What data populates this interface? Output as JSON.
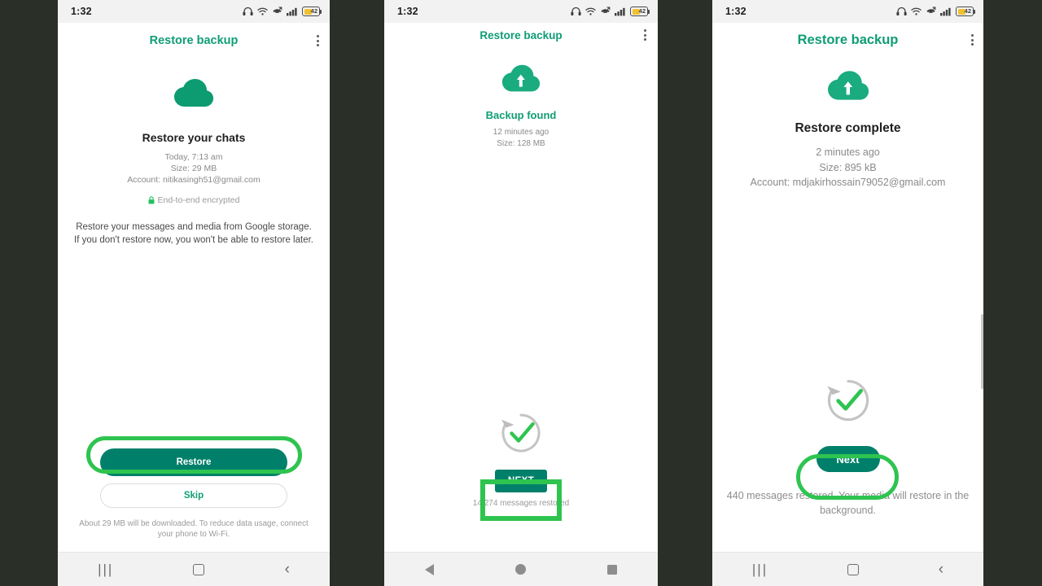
{
  "theme": {
    "page_background": "#2a2f28",
    "brand_green": "#0f9d74",
    "button_teal": "#00806a",
    "highlight_green": "#2ec44f",
    "battery_yellow": "#f0c030"
  },
  "status_bar": {
    "time": "1:32",
    "battery_level": "42",
    "icons": [
      "headphones-icon",
      "wifi-icon",
      "missed-call-icon",
      "signal-icon",
      "battery-icon"
    ]
  },
  "screens": [
    {
      "id": "restore-your-chats",
      "app_bar": {
        "title": "Restore backup",
        "overflow": "overflow-menu-icon"
      },
      "hero_icon": "cloud-icon",
      "headline": "Restore your chats",
      "meta_lines": [
        "Today, 7:13 am",
        "Size: 29 MB",
        "Account: nitikasingh51@gmail.com"
      ],
      "encryption_note": "End-to-end encrypted",
      "description": "Restore your messages and media from Google storage. If you don't restore now, you won't be able to restore later.",
      "primary_button": "Restore",
      "secondary_button": "Skip",
      "footnote": "About 29 MB will be downloaded. To reduce data usage, connect your phone to Wi-Fi.",
      "nav_style": "samsung",
      "nav_buttons": [
        "recents",
        "home",
        "back"
      ],
      "highlight_target": "Restore"
    },
    {
      "id": "backup-found",
      "app_bar": {
        "title": "Restore backup",
        "overflow": "overflow-menu-icon"
      },
      "hero_icon": "cloud-upload-icon",
      "headline": "Backup found",
      "meta_lines": [
        "12 minutes ago",
        "Size: 128 MB"
      ],
      "status_icon": "restore-check-icon",
      "primary_button": "NEXT",
      "footnote": "14,274 messages restored",
      "nav_style": "android",
      "nav_buttons": [
        "back",
        "home",
        "recents"
      ],
      "highlight_target": "NEXT"
    },
    {
      "id": "restore-complete",
      "app_bar": {
        "title": "Restore backup",
        "overflow": "overflow-menu-icon"
      },
      "hero_icon": "cloud-upload-icon",
      "headline": "Restore complete",
      "meta_lines": [
        "2 minutes ago",
        "Size: 895 kB",
        "Account: mdjakirhossain79052@gmail.com"
      ],
      "status_icon": "restore-check-icon",
      "primary_button": "Next",
      "footnote": "440 messages restored. Your media will restore in the background.",
      "nav_style": "samsung",
      "nav_buttons": [
        "recents",
        "home",
        "back"
      ],
      "highlight_target": "Next"
    }
  ]
}
